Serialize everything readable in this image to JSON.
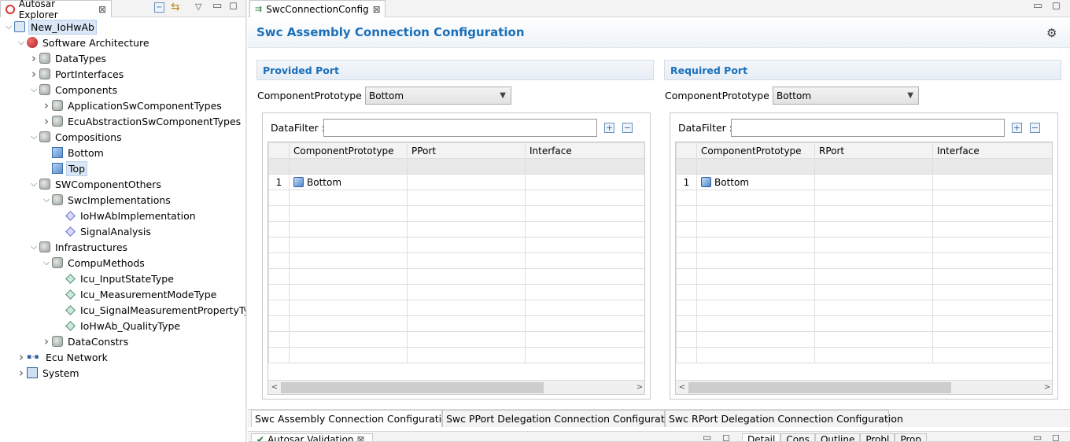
{
  "explorer": {
    "title": "Autosar Explorer",
    "tree": [
      {
        "label": "New_IoHwAb",
        "level": 0,
        "expanded": true,
        "icon": "project-icon",
        "selected": true
      },
      {
        "label": "Software Architecture",
        "level": 1,
        "expanded": true,
        "icon": "software-architecture-icon"
      },
      {
        "label": "DataTypes",
        "level": 2,
        "expanded": false,
        "icon": "package-icon"
      },
      {
        "label": "PortInterfaces",
        "level": 2,
        "expanded": false,
        "icon": "package-icon"
      },
      {
        "label": "Components",
        "level": 2,
        "expanded": true,
        "icon": "package-icon"
      },
      {
        "label": "ApplicationSwComponentTypes",
        "level": 3,
        "expanded": false,
        "icon": "package-icon"
      },
      {
        "label": "EcuAbstractionSwComponentTypes",
        "level": 3,
        "expanded": false,
        "icon": "package-icon"
      },
      {
        "label": "Compositions",
        "level": 2,
        "expanded": true,
        "icon": "package-icon"
      },
      {
        "label": "Bottom",
        "level": 3,
        "leaf": true,
        "icon": "composition-icon"
      },
      {
        "label": "Top",
        "level": 3,
        "leaf": true,
        "icon": "composition-icon",
        "highlighted": true
      },
      {
        "label": "SWComponentOthers",
        "level": 2,
        "expanded": true,
        "icon": "package-icon"
      },
      {
        "label": "SwcImplementations",
        "level": 3,
        "expanded": true,
        "icon": "package-icon"
      },
      {
        "label": "IoHwAbImplementation",
        "level": 4,
        "leaf": true,
        "icon": "implementation-icon"
      },
      {
        "label": "SignalAnalysis",
        "level": 4,
        "leaf": true,
        "icon": "implementation-icon"
      },
      {
        "label": "Infrastructures",
        "level": 2,
        "expanded": true,
        "icon": "package-icon"
      },
      {
        "label": "CompuMethods",
        "level": 3,
        "expanded": true,
        "icon": "package-icon"
      },
      {
        "label": "Icu_InputStateType",
        "level": 4,
        "leaf": true,
        "icon": "compu-method-icon"
      },
      {
        "label": "Icu_MeasurementModeType",
        "level": 4,
        "leaf": true,
        "icon": "compu-method-icon"
      },
      {
        "label": "Icu_SignalMeasurementPropertyTyp",
        "level": 4,
        "leaf": true,
        "icon": "compu-method-icon"
      },
      {
        "label": "IoHwAb_QualityType",
        "level": 4,
        "leaf": true,
        "icon": "compu-method-icon"
      },
      {
        "label": "DataConstrs",
        "level": 3,
        "expanded": false,
        "icon": "package-icon"
      },
      {
        "label": "Ecu Network",
        "level": 1,
        "expanded": false,
        "icon": "ecu-network-icon"
      },
      {
        "label": "System",
        "level": 1,
        "expanded": false,
        "icon": "system-icon"
      }
    ]
  },
  "editor": {
    "tab_title": "SwcConnectionConfig",
    "heading": "Swc Assembly Connection Configuration",
    "provided": {
      "section_title": "Provided Port",
      "prototype_label": "ComponentPrototype :",
      "prototype_value": "Bottom",
      "filter_label": "DataFilter :",
      "filter_value": "",
      "columns": [
        "ComponentPrototype",
        "PPort",
        "Interface"
      ],
      "rows": [
        {
          "num": "1",
          "prototype": "Bottom",
          "port": "",
          "interface": ""
        }
      ]
    },
    "required": {
      "section_title": "Required Port",
      "prototype_label": "ComponentPrototype :",
      "prototype_value": "Bottom",
      "filter_label": "DataFilter :",
      "filter_value": "",
      "columns": [
        "ComponentPrototype",
        "RPort",
        "Interface"
      ],
      "rows": [
        {
          "num": "1",
          "prototype": "Bottom",
          "port": "",
          "interface": ""
        }
      ]
    },
    "bottom_tabs": [
      "Swc Assembly Connection Configuration",
      "Swc PPort Delegation Connection Configuration",
      "Swc RPort Delegation Connection Configuration"
    ]
  },
  "lower_views": {
    "left_tab": "Autosar Validation",
    "right_tabs": [
      "Detail",
      "Cons",
      "Outline",
      "Probl",
      "Prop"
    ]
  },
  "colors": {
    "heading": "#1a6fb9",
    "selection": "#d9e7f7"
  }
}
